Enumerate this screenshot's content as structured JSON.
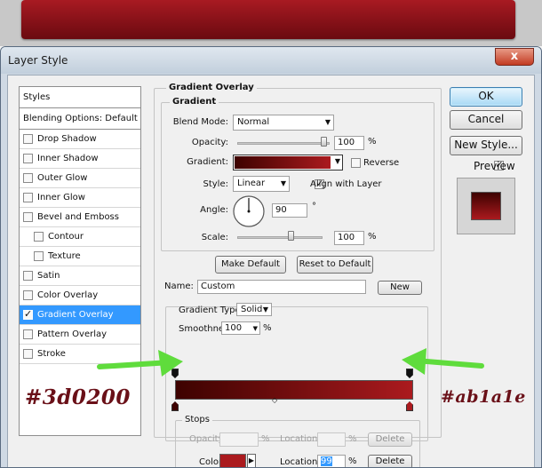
{
  "dialog": {
    "title": "Layer Style",
    "close_glyph": "x"
  },
  "styles_list": {
    "header": "Styles",
    "blending": "Blending Options: Default",
    "items": [
      {
        "label": "Drop Shadow",
        "checked": false,
        "selected": false,
        "indent": false
      },
      {
        "label": "Inner Shadow",
        "checked": false,
        "selected": false,
        "indent": false
      },
      {
        "label": "Outer Glow",
        "checked": false,
        "selected": false,
        "indent": false
      },
      {
        "label": "Inner Glow",
        "checked": false,
        "selected": false,
        "indent": false
      },
      {
        "label": "Bevel and Emboss",
        "checked": false,
        "selected": false,
        "indent": false
      },
      {
        "label": "Contour",
        "checked": false,
        "selected": false,
        "indent": true
      },
      {
        "label": "Texture",
        "checked": false,
        "selected": false,
        "indent": true
      },
      {
        "label": "Satin",
        "checked": false,
        "selected": false,
        "indent": false
      },
      {
        "label": "Color Overlay",
        "checked": false,
        "selected": false,
        "indent": false
      },
      {
        "label": "Gradient Overlay",
        "checked": true,
        "selected": true,
        "indent": false
      },
      {
        "label": "Pattern Overlay",
        "checked": false,
        "selected": false,
        "indent": false
      },
      {
        "label": "Stroke",
        "checked": false,
        "selected": false,
        "indent": false
      }
    ]
  },
  "gradient_overlay": {
    "section_title": "Gradient Overlay",
    "subsection_title": "Gradient",
    "blend_mode_label": "Blend Mode:",
    "blend_mode": "Normal",
    "opacity_label": "Opacity:",
    "opacity": "100",
    "percent": "%",
    "gradient_label": "Gradient:",
    "reverse_label": "Reverse",
    "reverse": false,
    "style_label": "Style:",
    "style": "Linear",
    "align_label": "Align with Layer",
    "align": true,
    "angle_label": "Angle:",
    "angle": "90",
    "degree": "°",
    "scale_label": "Scale:",
    "scale": "100",
    "make_default": "Make Default",
    "reset_default": "Reset to Default"
  },
  "editor": {
    "name_label": "Name:",
    "name_value": "Custom",
    "new_button": "New",
    "gradient_type_label": "Gradient Type:",
    "gradient_type": "Solid",
    "smoothness_label": "Smoothness:",
    "smoothness": "100",
    "percent": "%",
    "stops_title": "Stops",
    "opacity_label": "Opacity:",
    "location_label": "Location:",
    "delete_label": "Delete",
    "color_label": "Color:",
    "location_value": "99",
    "color_stop_start": "#3d0200",
    "color_stop_end": "#ab1a1e",
    "active_stop_color": "#ab1a1e"
  },
  "actions": {
    "ok": "OK",
    "cancel": "Cancel",
    "new_style": "New Style...",
    "preview_label": "Preview",
    "preview": true
  },
  "annotations": {
    "left_color": "#3d0200",
    "right_color": "#ab1a1e",
    "arrow_color": "#66dd44"
  }
}
